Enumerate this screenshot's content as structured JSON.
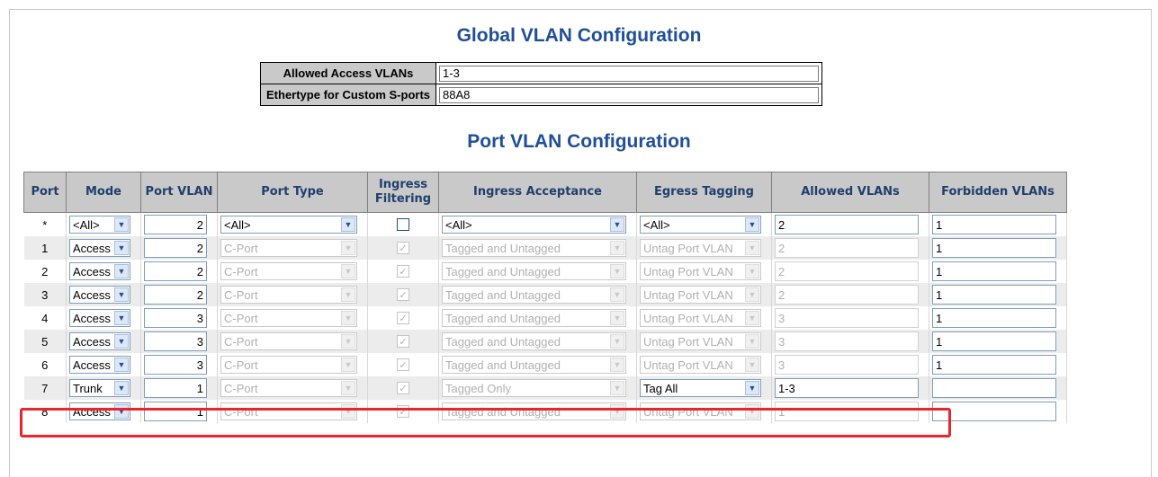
{
  "global": {
    "title": "Global VLAN Configuration",
    "rows": [
      {
        "label": "Allowed Access VLANs",
        "value": "1-3"
      },
      {
        "label": "Ethertype for Custom S-ports",
        "value": "88A8"
      }
    ]
  },
  "port": {
    "title": "Port VLAN Configuration",
    "headers": {
      "port": "Port",
      "mode": "Mode",
      "port_vlan": "Port VLAN",
      "port_type": "Port Type",
      "ingress_filtering": "Ingress Filtering",
      "ingress_acceptance": "Ingress Acceptance",
      "egress_tagging": "Egress Tagging",
      "allowed_vlans": "Allowed VLANs",
      "forbidden_vlans": "Forbidden VLANs"
    },
    "rows": [
      {
        "port": "*",
        "mode": "<All>",
        "pvid": "2",
        "type": "<All>",
        "filter": false,
        "acceptance": "<All>",
        "egress": "<All>",
        "allowed": "2",
        "forbidden": "1",
        "disabled": false
      },
      {
        "port": "1",
        "mode": "Access",
        "pvid": "2",
        "type": "C-Port",
        "filter": true,
        "acceptance": "Tagged and Untagged",
        "egress": "Untag Port VLAN",
        "allowed": "2",
        "forbidden": "1",
        "disabled": true
      },
      {
        "port": "2",
        "mode": "Access",
        "pvid": "2",
        "type": "C-Port",
        "filter": true,
        "acceptance": "Tagged and Untagged",
        "egress": "Untag Port VLAN",
        "allowed": "2",
        "forbidden": "1",
        "disabled": true
      },
      {
        "port": "3",
        "mode": "Access",
        "pvid": "2",
        "type": "C-Port",
        "filter": true,
        "acceptance": "Tagged and Untagged",
        "egress": "Untag Port VLAN",
        "allowed": "2",
        "forbidden": "1",
        "disabled": true
      },
      {
        "port": "4",
        "mode": "Access",
        "pvid": "3",
        "type": "C-Port",
        "filter": true,
        "acceptance": "Tagged and Untagged",
        "egress": "Untag Port VLAN",
        "allowed": "3",
        "forbidden": "1",
        "disabled": true
      },
      {
        "port": "5",
        "mode": "Access",
        "pvid": "3",
        "type": "C-Port",
        "filter": true,
        "acceptance": "Tagged and Untagged",
        "egress": "Untag Port VLAN",
        "allowed": "3",
        "forbidden": "1",
        "disabled": true
      },
      {
        "port": "6",
        "mode": "Access",
        "pvid": "3",
        "type": "C-Port",
        "filter": true,
        "acceptance": "Tagged and Untagged",
        "egress": "Untag Port VLAN",
        "allowed": "3",
        "forbidden": "1",
        "disabled": true
      },
      {
        "port": "7",
        "mode": "Trunk",
        "pvid": "1",
        "type": "C-Port",
        "filter": true,
        "acceptance": "Tagged Only",
        "egress": "Tag All",
        "allowed": "1-3",
        "forbidden": "",
        "disabled": true,
        "egress_enabled": true,
        "allowed_enabled": true
      },
      {
        "port": "8",
        "mode": "Access",
        "pvid": "1",
        "type": "C-Port",
        "filter": true,
        "acceptance": "Tagged and Untagged",
        "egress": "Untag Port VLAN",
        "allowed": "1",
        "forbidden": "",
        "disabled": true
      }
    ]
  },
  "colors": {
    "title": "#1f4e9a",
    "header_bg": "#c9c9c9",
    "highlight": "#e8262c"
  }
}
